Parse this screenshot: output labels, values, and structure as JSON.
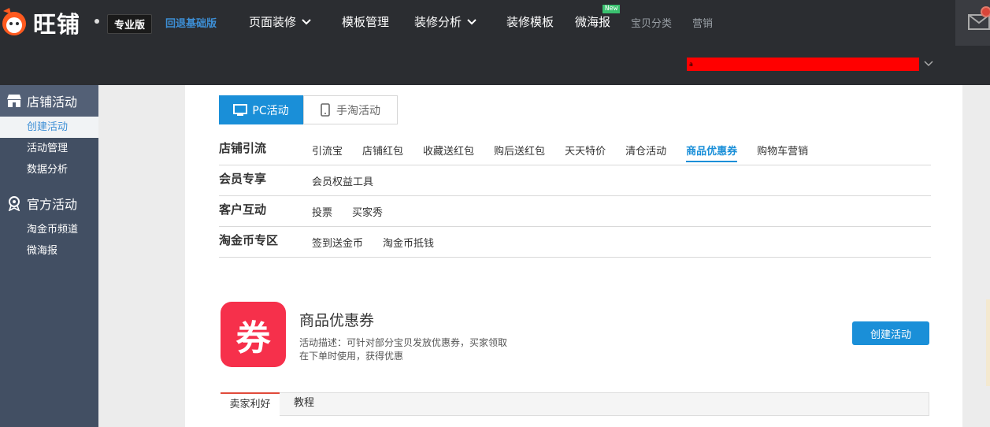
{
  "header": {
    "logo_text": "旺铺",
    "edition": "专业版",
    "downgrade_link": "回退基础版",
    "nav": [
      {
        "label": "页面装修",
        "has_dropdown": true
      },
      {
        "label": "模板管理",
        "has_dropdown": false
      },
      {
        "label": "装修分析",
        "has_dropdown": true
      },
      {
        "label": "装修模板",
        "has_dropdown": false
      },
      {
        "label": "微海报",
        "badge": "New"
      },
      {
        "label": "宝贝分类"
      },
      {
        "label": "营销"
      }
    ],
    "shop_selector_value": "a",
    "colors": {
      "bar": "#2b2d31",
      "accent": "#1a8fd8",
      "brand_red": "#f6304b"
    }
  },
  "sidebar": {
    "sections": [
      {
        "title": "店铺活动",
        "icon": "store-icon",
        "items": [
          "创建活动",
          "活动管理",
          "数据分析"
        ],
        "selected": "创建活动"
      },
      {
        "title": "官方活动",
        "icon": "location-badge-icon",
        "items": [
          "淘金币频道",
          "微海报"
        ]
      }
    ]
  },
  "main": {
    "platform_tabs": [
      {
        "label": "PC活动",
        "icon": "monitor-icon",
        "active": true
      },
      {
        "label": "手淘活动",
        "icon": "phone-icon",
        "active": false
      }
    ],
    "categories": [
      {
        "title": "店铺引流",
        "links": [
          "引流宝",
          "店铺红包",
          "收藏送红包",
          "购后送红包",
          "天天特价",
          "清仓活动",
          "商品优惠券",
          "购物车营销"
        ],
        "active": "商品优惠券"
      },
      {
        "title": "会员专享",
        "links": [
          "会员权益工具"
        ]
      },
      {
        "title": "客户互动",
        "links": [
          "投票",
          "买家秀"
        ]
      },
      {
        "title": "淘金币专区",
        "links": [
          "签到送金币",
          "淘金币抵钱"
        ]
      }
    ],
    "activity": {
      "icon_char": "券",
      "title": "商品优惠券",
      "desc_line1": "活动描述：可针对部分宝贝发放优惠券，买家领取",
      "desc_line2": "在下单时使用，获得优惠",
      "create_button": "创建活动"
    },
    "detail_tabs": [
      "卖家利好",
      "教程"
    ]
  }
}
